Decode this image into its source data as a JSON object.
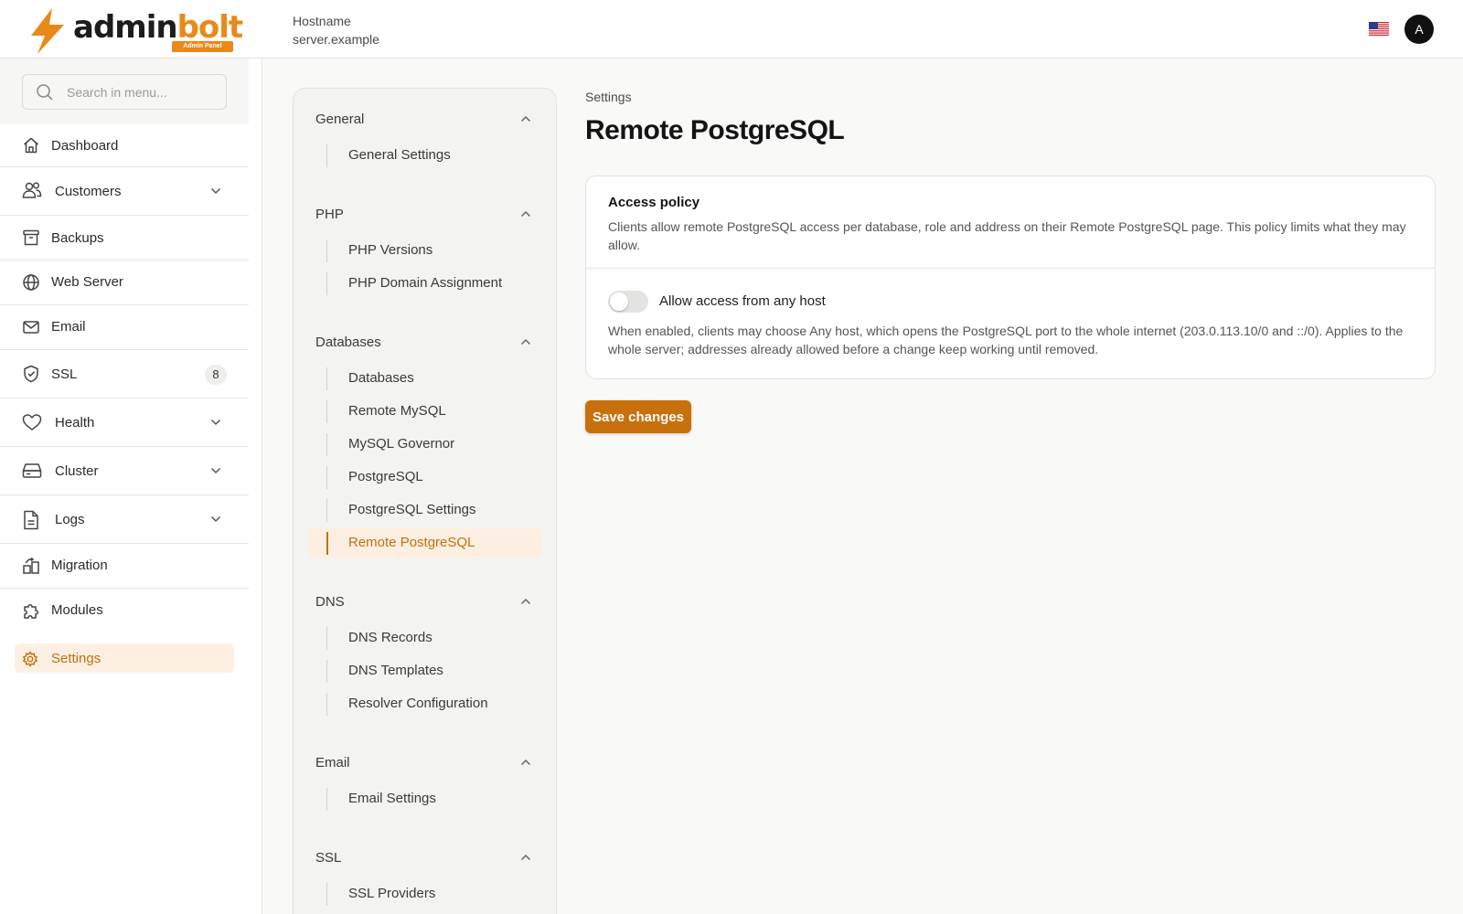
{
  "header": {
    "logo": {
      "word_dark": "admin",
      "word_accent": "bolt",
      "badge": "Admin Panel"
    },
    "hostname_label": "Hostname",
    "hostname_value": "server.example",
    "avatar_initial": "A",
    "flag_icon": "us-flag-icon"
  },
  "colors": {
    "accent": "#c8700c",
    "accent_text": "#c2700f",
    "active_bg": "#fdf0e3",
    "logo_accent": "#e8891a"
  },
  "sidebar": {
    "search_placeholder": "Search in menu...",
    "items": [
      {
        "label": "Dashboard",
        "icon": "home-icon"
      },
      {
        "label": "Customers",
        "icon": "users-icon",
        "expandable": true
      },
      {
        "label": "Backups",
        "icon": "archive-icon"
      },
      {
        "label": "Web Server",
        "icon": "globe-icon"
      },
      {
        "label": "Email",
        "icon": "mail-icon"
      },
      {
        "label": "SSL",
        "icon": "shield-icon",
        "badge": "8"
      },
      {
        "label": "Health",
        "icon": "heart-icon",
        "expandable": true
      },
      {
        "label": "Cluster",
        "icon": "server-icon",
        "expandable": true
      },
      {
        "label": "Logs",
        "icon": "file-icon",
        "expandable": true
      },
      {
        "label": "Migration",
        "icon": "migration-icon"
      },
      {
        "label": "Modules",
        "icon": "puzzle-icon"
      },
      {
        "label": "Settings",
        "icon": "gear-icon",
        "active": true
      }
    ]
  },
  "settings_nav": {
    "groups": [
      {
        "title": "General",
        "items": [
          "General Settings"
        ]
      },
      {
        "title": "PHP",
        "items": [
          "PHP Versions",
          "PHP Domain Assignment"
        ]
      },
      {
        "title": "Databases",
        "items": [
          "Databases",
          "Remote MySQL",
          "MySQL Governor",
          "PostgreSQL",
          "PostgreSQL Settings",
          "Remote PostgreSQL"
        ]
      },
      {
        "title": "DNS",
        "items": [
          "DNS Records",
          "DNS Templates",
          "Resolver Configuration"
        ]
      },
      {
        "title": "Email",
        "items": [
          "Email Settings"
        ]
      },
      {
        "title": "SSL",
        "items": [
          "SSL Providers"
        ]
      }
    ],
    "active_item": "Remote PostgreSQL"
  },
  "main": {
    "breadcrumb": "Settings",
    "title": "Remote PostgreSQL",
    "card": {
      "title": "Access policy",
      "description": "Clients allow remote PostgreSQL access per database, role and address on their Remote PostgreSQL page. This policy limits what they may allow.",
      "toggle_label": "Allow access from any host",
      "toggle_on": false,
      "toggle_help": "When enabled, clients may choose Any host, which opens the PostgreSQL port to the whole internet (203.0.113.10/0 and ::/0). Applies to the whole server; addresses already allowed before a change keep working until removed."
    },
    "save_label": "Save changes"
  }
}
